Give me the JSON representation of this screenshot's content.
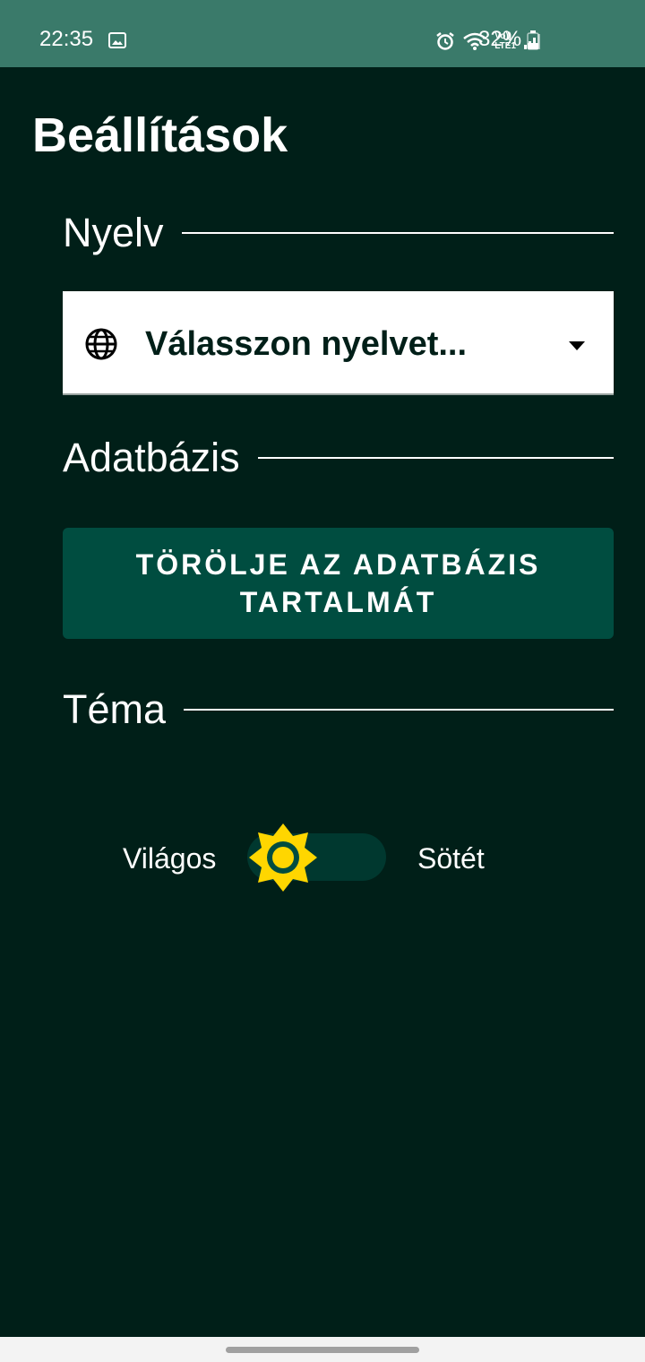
{
  "status_bar": {
    "time": "22:35",
    "battery_percent": "32%",
    "icons": [
      "image-icon",
      "alarm-icon",
      "wifi-icon",
      "volte-icon",
      "signal-icon",
      "battery-icon"
    ],
    "volte_line1": "Vo))",
    "volte_line2": "LTE1"
  },
  "page": {
    "title": "Beállítások"
  },
  "sections": {
    "language": {
      "label": "Nyelv",
      "select_value": "Válasszon nyelvet...",
      "icon": "globe-icon"
    },
    "database": {
      "label": "Adatbázis",
      "clear_button_label": "TÖRÖLJE AZ ADATBÁZIS TARTALMÁT"
    },
    "theme": {
      "label": "Téma",
      "light_label": "Világos",
      "dark_label": "Sötét",
      "selected": "light",
      "toggle_icon": "sun-icon"
    }
  },
  "colors": {
    "background": "#001f18",
    "status_bar": "#3a7a6a",
    "button": "#004d40",
    "switch_track": "#00382f",
    "sun": "#ffd600"
  }
}
